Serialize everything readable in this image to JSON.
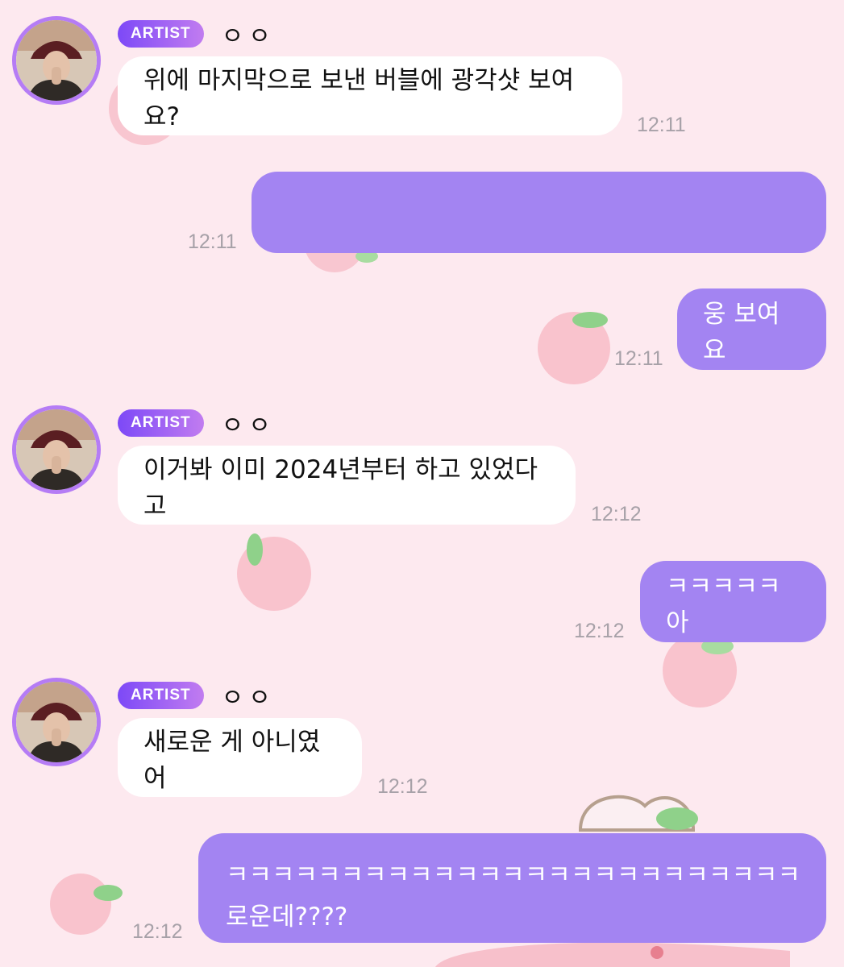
{
  "colors": {
    "background": "#fde9ef",
    "badge_gradient_start": "#7d49f7",
    "badge_gradient_end": "#c17cf0",
    "incoming_bubble": "#ffffff",
    "outgoing_bubble": "#a384f2",
    "timestamp": "#a7a1a8",
    "avatar_ring": "#b57cf5"
  },
  "messages": [
    {
      "sender": "artist",
      "badge": "ARTIST",
      "name": "ㅇㅇ",
      "text": "위에 마지막으로 보낸 버블에 광각샷 보여요?",
      "time": "12:11"
    },
    {
      "sender": "me",
      "text": "",
      "time": "12:11"
    },
    {
      "sender": "me",
      "text": "웅 보여요",
      "time": "12:11"
    },
    {
      "sender": "artist",
      "badge": "ARTIST",
      "name": "ㅇㅇ",
      "text": "이거봐 이미 2024년부터 하고 있었다고",
      "time": "12:12"
    },
    {
      "sender": "me",
      "text": "ㅋㅋㅋㅋㅋ아",
      "time": "12:12"
    },
    {
      "sender": "artist",
      "badge": "ARTIST",
      "name": "ㅇㅇ",
      "text": "새로운 게 아니였어",
      "time": "12:12"
    },
    {
      "sender": "me",
      "text_line1": "ㅋㅋㅋㅋㅋㅋㅋㅋㅋㅋㅋㅋㅋㅋㅋㅋㅋㅋㅋㅋㅋㅋㅋㅋㅋㅋ 아니 새",
      "text_line2": "로운데????",
      "time": "12:12"
    }
  ]
}
